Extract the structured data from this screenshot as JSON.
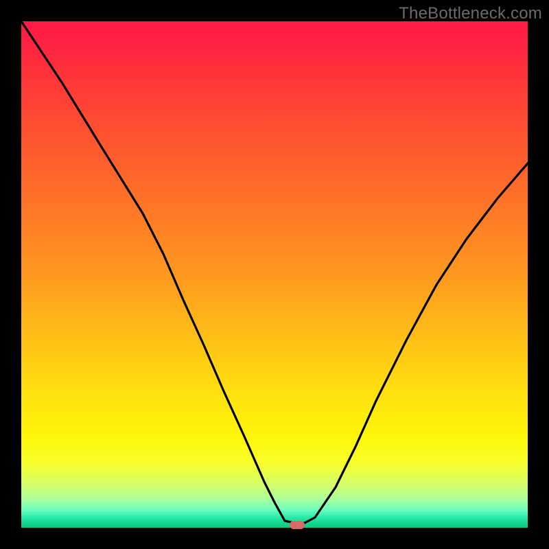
{
  "watermark": "TheBottleneck.com",
  "marker": {
    "x_pct": 54.5,
    "y_pct": 99.4
  },
  "chart_data": {
    "type": "line",
    "title": "",
    "xlabel": "",
    "ylabel": "",
    "xlim": [
      0,
      100
    ],
    "ylim": [
      0,
      100
    ],
    "series": [
      {
        "name": "bottleneck-curve",
        "x": [
          0,
          8,
          16,
          24,
          28,
          32,
          36,
          40,
          44,
          48,
          50,
          52,
          54,
          56,
          58,
          62,
          66,
          70,
          76,
          82,
          88,
          94,
          100
        ],
        "values": [
          100,
          88,
          75,
          62,
          54,
          45,
          36,
          27,
          18,
          9,
          5,
          1.3,
          0.9,
          0.9,
          2,
          8,
          16,
          25,
          37,
          48,
          57,
          65,
          72
        ]
      }
    ],
    "annotations": [
      {
        "type": "marker",
        "x": 54.5,
        "y": 0.6,
        "label": "optimal-point"
      }
    ]
  }
}
